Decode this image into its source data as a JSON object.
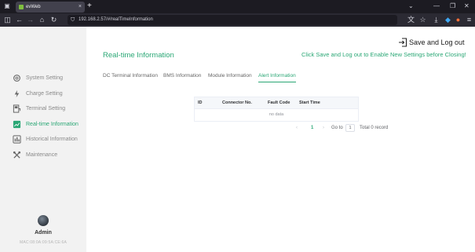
{
  "browser": {
    "tab_title": "evWeb",
    "tab_close": "×",
    "new_tab": "+",
    "url": "192.168.2.57/#/realTimeInformation"
  },
  "sidebar": {
    "items": [
      {
        "label": "System Setting",
        "icon": "gear-icon",
        "active": false
      },
      {
        "label": "Charge Setting",
        "icon": "charge-icon",
        "active": false
      },
      {
        "label": "Terminal Setting",
        "icon": "terminal-icon",
        "active": false
      },
      {
        "label": "Real-time Information",
        "icon": "realtime-icon",
        "active": true
      },
      {
        "label": "Historical Information",
        "icon": "history-icon",
        "active": false
      },
      {
        "label": "Maintenance",
        "icon": "tools-icon",
        "active": false
      }
    ],
    "user": {
      "name": "Admin",
      "mac": "MAC:08:0A:09:5A:CE:6A"
    }
  },
  "header": {
    "save_logout": "Save and Log out",
    "title": "Real-time Information",
    "notice": "Click Save and Log out to Enable New Settings before Closing!"
  },
  "tabs": [
    {
      "label": "DC Terminal Information",
      "active": false
    },
    {
      "label": "BMS Information",
      "active": false
    },
    {
      "label": "Module Information",
      "active": false
    },
    {
      "label": "Alert Information",
      "active": true
    }
  ],
  "table": {
    "columns": [
      "ID",
      "Connector No.",
      "Fault Code",
      "Start Time"
    ],
    "empty_text": "no data"
  },
  "pagination": {
    "prev": "‹",
    "current_page": "1",
    "next": "›",
    "goto_label": "Go to",
    "goto_value": "1",
    "total": "Total 0 record"
  },
  "colors": {
    "accent": "#2aa775",
    "sidebar_bg": "#f2f2f2",
    "browser_dark": "#1c1b22"
  }
}
